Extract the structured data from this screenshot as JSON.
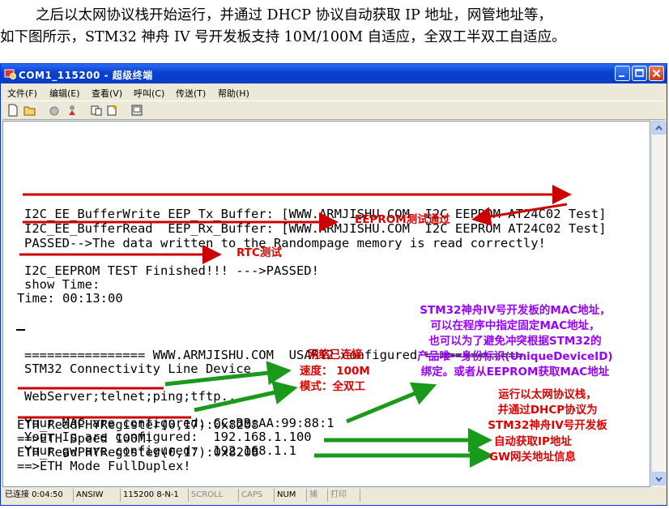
{
  "intro": {
    "line1": "之后以太网协议栈开始运行，并通过 DHCP 协议自动获取 IP 地址，网管地址等，",
    "line2": "如下图所示，STM32 神舟 IV 号开发板支持 10M/100M 自适应，全双工半双工自适应。"
  },
  "window": {
    "title": "COM1_115200 - 超级终端"
  },
  "menu": [
    "文件(F)",
    "编辑(E)",
    "查看(V)",
    "呼叫(C)",
    "传送(T)",
    "帮助(H)"
  ],
  "toolbar": [
    "new-icon",
    "open-icon",
    "disconnect-icon",
    "properties-icon",
    "send-icon",
    "receive-icon",
    "settings-icon"
  ],
  "terminal": {
    "lines": [
      "I2C_EE_BufferWrite EEP_Tx_Buffer: [WWW.ARMJISHU.COM  I2C EEPROM AT24C02 Test]",
      "I2C_EE_BufferRead  EEP_Rx_Buffer: [WWW.ARMJISHU.COM  I2C EEPROM AT24C02 Test]",
      "PASSED-->The data written to the Randompage memory is read correctly!",
      "I2C_EEPROM TEST Finished!!! --->PASSED!",
      "show Time:",
      "Time: 00:13:00",
      "================ WWW.ARMJISHU.COM  USART2 configured =============",
      "STM32 Connectivity Line Device",
      "WebServer;telnet;ping;tftp....",
      "ETH_ReadPHYRegister(0,17):0x8208",
      "==>ETH Speed 100M!",
      "ETH_ReadPHYRegister(0,17):0x8208",
      "==>ETH Mode FullDuplex!",
      "Your MAC are configured: CC:BB:AA:99:88:1",
      "Your Ip are configured:  192.168.1.100",
      "Your gw are configured:  192.168.1.1"
    ]
  },
  "annotations": {
    "eeprom": "EEPROM测试通过",
    "rtc": "RTC测试",
    "net_connected": "网络已连接",
    "speed": "速度：  100M",
    "mode": "模式：全双工",
    "mac_note": [
      "STM32神舟IV号开发板的MAC地址，",
      "可以在程序中指定固定MAC地址，",
      "也可以为了避免冲突根据STM32的",
      "产品唯一身份标识(UniqueDeviceID)",
      "绑定。或者从EEPROM获取MAC地址"
    ],
    "dhcp_note": [
      "运行以太网协议栈，",
      "并通过DHCP协议为",
      "STM32神舟IV号开发板"
    ],
    "ip_note": "自动获取IP地址",
    "gw_note": "GW网关地址信息"
  },
  "status": {
    "connected": "已连接 0:04:50",
    "emulation": "ANSIW",
    "settings": "115200 8-N-1",
    "scroll": "SCROLL",
    "caps": "CAPS",
    "num": "NUM",
    "capture": "捕",
    "print": "打印"
  },
  "colors": {
    "title_bar": "#0a3fd0",
    "red_annotation": "#e00000",
    "green_arrow": "#1a9a1a",
    "purple_annotation": "#9900ff"
  }
}
